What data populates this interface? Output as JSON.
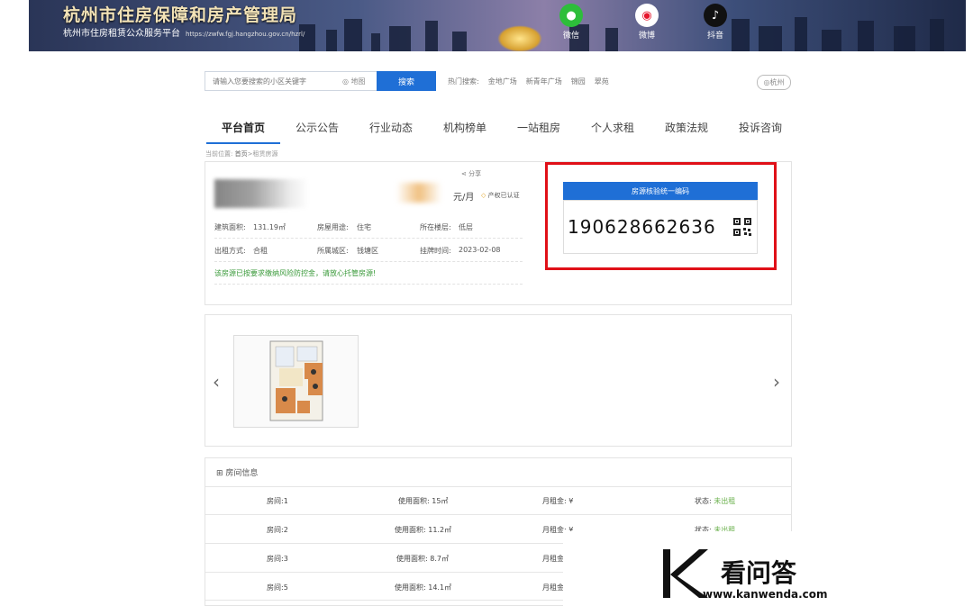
{
  "banner": {
    "title": "杭州市住房保障和房产管理局",
    "subtitle": "杭州市住房租赁公众服务平台",
    "url": "https://zwfw.fgj.hangzhou.gov.cn/hzrl/",
    "social": [
      {
        "label": "微信",
        "icon": "wechat-icon"
      },
      {
        "label": "微博",
        "icon": "weibo-icon"
      },
      {
        "label": "抖音",
        "icon": "douyin-icon"
      }
    ]
  },
  "search": {
    "placeholder": "请输入您要搜索的小区关键字",
    "map_label": "地图",
    "button": "搜索",
    "hot_label": "热门搜索:",
    "hot_items": [
      "金地广场",
      "新青年广场",
      "锦园",
      "翠苑"
    ],
    "city": "杭州"
  },
  "nav": [
    "平台首页",
    "公示公告",
    "行业动态",
    "机构榜单",
    "一站租房",
    "个人求租",
    "政策法规",
    "投诉咨询"
  ],
  "breadcrumb": {
    "prefix": "当前位置:",
    "home": "首页",
    "sep": ">",
    "current": "租赁房源"
  },
  "listing": {
    "share": "分享",
    "price_unit": "元/月",
    "verified": "产权已认证",
    "fields": [
      {
        "label": "建筑面积:",
        "value": "131.19㎡"
      },
      {
        "label": "房屋用途:",
        "value": "住宅"
      },
      {
        "label": "所在楼层:",
        "value": "低层"
      },
      {
        "label": "出租方式:",
        "value": "合租"
      },
      {
        "label": "所属城区:",
        "value": "钱塘区"
      },
      {
        "label": "挂牌时间:",
        "value": "2023-02-08"
      }
    ],
    "notice": "该房源已按要求缴纳风险防控金，请放心托管房源!"
  },
  "verify": {
    "heading": "房源核验统一编码",
    "code": "190628662636"
  },
  "rooms": {
    "title": "房间信息",
    "rows": [
      {
        "room": "房间:1",
        "area": "使用面积: 15㎡",
        "rent": "月租金: ¥",
        "status_label": "状态:",
        "status": "未出租"
      },
      {
        "room": "房间:2",
        "area": "使用面积: 11.2㎡",
        "rent": "月租金: ¥",
        "status_label": "状态:",
        "status": "未出租"
      },
      {
        "room": "房间:3",
        "area": "使用面积: 8.7㎡",
        "rent": "月租金: ¥",
        "status_label": "",
        "status": ""
      },
      {
        "room": "房间:5",
        "area": "使用面积: 14.1㎡",
        "rent": "月租金: ¥",
        "status_label": "",
        "status": ""
      }
    ]
  },
  "watermark": {
    "text": "看问答",
    "url": "www.kanwenda.com"
  }
}
